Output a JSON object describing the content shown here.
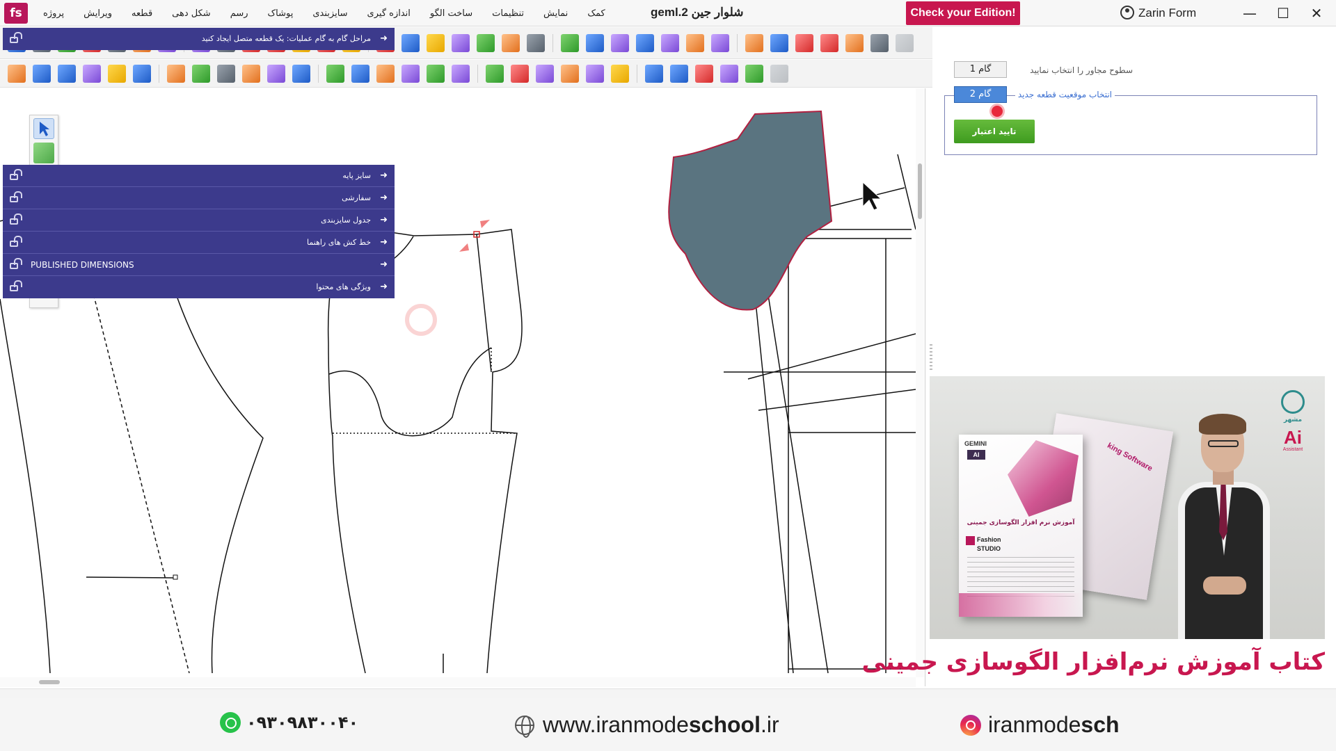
{
  "titlebar": {
    "logo_text": "fs",
    "menu": [
      "پروژه",
      "ویرایش",
      "قطعه",
      "شکل دهی",
      "رسم",
      "پوشاک",
      "سایزبندی",
      "اندازه گیری",
      "ساخت الگو",
      "تنظیمات",
      "نمایش",
      "کمک"
    ],
    "document_title": "شلوار جین geml.2",
    "edition_button": "Check your Edition!",
    "user_name": "Zarin Form",
    "window_controls": [
      "—",
      "☐",
      "✕"
    ]
  },
  "toolbars": {
    "row1_icons": [
      "new-piece-icon",
      "open-icon",
      "print-icon",
      "save-icon",
      "hierarchy-icon",
      "undo-icon",
      "redo-icon",
      "zoom-fit-icon",
      "zoom-window-icon",
      "zoom-in-icon",
      "text-icon",
      "notch-icon",
      "trace-icon",
      "layers-icon",
      "folder-icon",
      "folder-icon",
      "play-icon",
      "marker-icon",
      "rotate-icon",
      "grid-icon",
      "eye-icon",
      "pins-icon",
      "layout-icon",
      "3d-icon",
      "measure-icon",
      "pin-icon",
      "fork-icon",
      "move-icon",
      "table-icon",
      "report-icon",
      "printer-icon",
      "plot-icon",
      "package-icon",
      "export-icon",
      "disabled-icon"
    ],
    "row2_icons": [
      "piece-icon",
      "select-icon",
      "cut-icon",
      "basket-icon",
      "color-icon",
      "transfer-icon",
      "transfer-icon",
      "copy-icon",
      "copy-icon",
      "offset-icon",
      "offset-icon",
      "seam-icon",
      "add-icon",
      "group-icon",
      "merge-icon",
      "split-icon",
      "align-icon",
      "mirror-icon",
      "rotate-icon",
      "scale-icon",
      "lock-icon",
      "notch-icon",
      "arrow-icon",
      "next-icon",
      "measure-icon",
      "fold-icon",
      "cross-icon",
      "snap-icon",
      "node-icon",
      "disabled-icon"
    ],
    "vertical_tools": [
      "select-arrow-icon",
      "curve-tool-icon",
      "eraser-icon",
      "pin-tool-icon",
      "ruler-icon",
      "tape-measure-icon",
      "nodes-icon"
    ]
  },
  "panel": {
    "header": "مراحل گام به گام عملیات: یک قطعه متصل ایجاد کنید",
    "step1_label": "سطوح مجاور را انتخاب نمایید",
    "step1_button": "گام 1",
    "step2_label": "انتخاب موقعیت قطعه جدید",
    "step2_button": "گام 2",
    "confirm_button": "تایید اعتبار",
    "sections": [
      "سایز پایه",
      "سفارشی",
      "جدول سایزبندی",
      "خط کش های راهنما",
      "PUBLISHED DIMENSIONS",
      "ویژگی های محتوا"
    ],
    "arrow_glyph": "➜"
  },
  "ad": {
    "book_gemini_label": "GEMINI",
    "book_ai_label": "AI",
    "book_title": "آموزش نرم افزار الگوسازی جمینی",
    "book_brand_line1": "Fashion",
    "book_brand_line2": "STUDIO",
    "back_book_title": "king Software",
    "logo_word": "مشهر",
    "logo_ai": "Ai",
    "logo_ai_sub": "Assistant",
    "caption": "کتاب آموزش نرم‌افزار الگوسازی جمینی"
  },
  "footer": {
    "phone": "۰۹۳۰۹۸۳۰۰۴۰",
    "website_prefix": "www.iranmode",
    "website_bold": "school",
    "website_suffix": ".ir",
    "instagram_prefix": "iranmode",
    "instagram_bold": "sch"
  },
  "colors": {
    "accent": "#c8174f",
    "panel_bar": "#3c3a8c",
    "piece_fill": "#5a7480",
    "piece_stroke": "#b02040",
    "confirm_green": "#4fae2a"
  }
}
